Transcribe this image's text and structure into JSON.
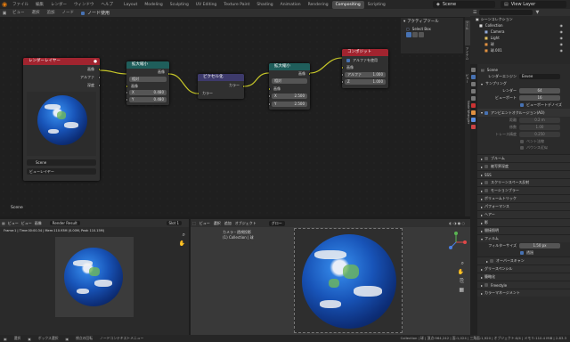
{
  "topbar": {
    "menus": [
      "ファイル",
      "編集",
      "レンダー",
      "ウィンドウ",
      "ヘルプ"
    ],
    "workspaces": [
      "Layout",
      "Modeling",
      "Sculpting",
      "UV Editing",
      "Texture Paint",
      "Shading",
      "Animation",
      "Rendering",
      "Compositing",
      "Scripting"
    ],
    "active_workspace": "Compositing",
    "scene": "Scene",
    "view_layer": "View Layer"
  },
  "node_header": {
    "items": [
      "ビュー",
      "選択",
      "追加",
      "ノード"
    ],
    "use_nodes": "ノード使用"
  },
  "nodes": {
    "render_layers": {
      "title": "レンダーレイヤー",
      "outputs": [
        "画像",
        "アルファ",
        "深度"
      ],
      "scene": "Scene",
      "layer": "ビューレイヤー"
    },
    "scale1": {
      "title": "拡大縮小",
      "out": "画像",
      "mode": "相対",
      "input": "画像",
      "x_label": "X",
      "x": "0.480",
      "y_label": "Y",
      "y": "0.480"
    },
    "pixelate": {
      "title": "ピクセル化",
      "out": "カラー",
      "input": "カラー"
    },
    "scale2": {
      "title": "拡大縮小",
      "out": "画像",
      "mode": "相対",
      "input": "画像",
      "x_label": "X",
      "x": "2.500",
      "y_label": "Y",
      "y": "2.500"
    },
    "composite": {
      "title": "コンポジット",
      "alpha": "アルファを使用",
      "input": "画像",
      "a_label": "アルファ",
      "a": "1.000",
      "z_label": "Z",
      "z": "1.000"
    }
  },
  "tool_panel": {
    "title": "アクティブツール",
    "tool": "Select Box"
  },
  "side_tabs": [
    "ツール",
    "アイテム",
    "ビュー",
    "Node Wrangler"
  ],
  "node_label": "Scene",
  "outliner": {
    "title": "シーンコレクション",
    "items": [
      "Collection",
      "Camera",
      "Light",
      "球",
      "球.001"
    ]
  },
  "props": {
    "scene": "Scene",
    "engine_label": "レンダーエンジン",
    "engine": "Eevee",
    "sampling": "サンプリング",
    "render_label": "レンダー",
    "render": "64",
    "viewport_label": "ビューポート",
    "viewport": "16",
    "denoise": "ビューポートデノイズ",
    "ao": "アンビエントオクルージョン(AO)",
    "ao_rows": [
      {
        "l": "距離",
        "v": "0.2 m"
      },
      {
        "l": "係数",
        "v": "1.00"
      },
      {
        "l": "トレース精度",
        "v": "0.250"
      }
    ],
    "ao_checks": [
      "ベント法線",
      "バウンス近似"
    ],
    "sections": [
      "ブルーム",
      "被写界深度",
      "SSS",
      "スクリーンスペース反射",
      "モーションブラー",
      "ボリュームトリック",
      "パフォーマンス",
      "ヘアー",
      "影",
      "間接照明",
      "フィルム"
    ],
    "filter_label": "フィルターサイズ",
    "filter": "1.50 px",
    "transparent": "透過",
    "sections2": [
      "オーバースキャン",
      "グリースペンシル",
      "簡略化",
      "Freestyle",
      "カラーマネージメント"
    ]
  },
  "image_editor": {
    "menus": [
      "ビュー",
      "ビュー",
      "画像"
    ],
    "image": "Render Result",
    "slot": "Slot 1",
    "info": "Frame:1 | Time:00:00.34 | Mem:110.93M (0.00M, Peak 110.15M)"
  },
  "viewport": {
    "menus": [
      "ビュー",
      "選択",
      "追加",
      "オブジェクト"
    ],
    "mode": "グロー",
    "line1": "カメラ・透視投影",
    "line2": "(1) Collection | 球"
  },
  "statusbar": {
    "items": [
      "選択",
      "ボックス選択",
      "視点の回転",
      "ノードコンテキストメニュー"
    ],
    "stats": "Collection | 球 | 頂点:964,242 | 面:1,024 | 三角面:1,920 | オブジェクト:0/4 | メモリ:110.4 MiB | 2.83.3"
  },
  "colors": {
    "accent": "#4772b3",
    "node_red": "#a1242f",
    "node_teal": "#1f5e5b",
    "node_purple": "#3d3a6b",
    "socket_yellow": "#c7c729",
    "socket_grey": "#a1a1a1",
    "socket_purple": "#6363c7"
  }
}
